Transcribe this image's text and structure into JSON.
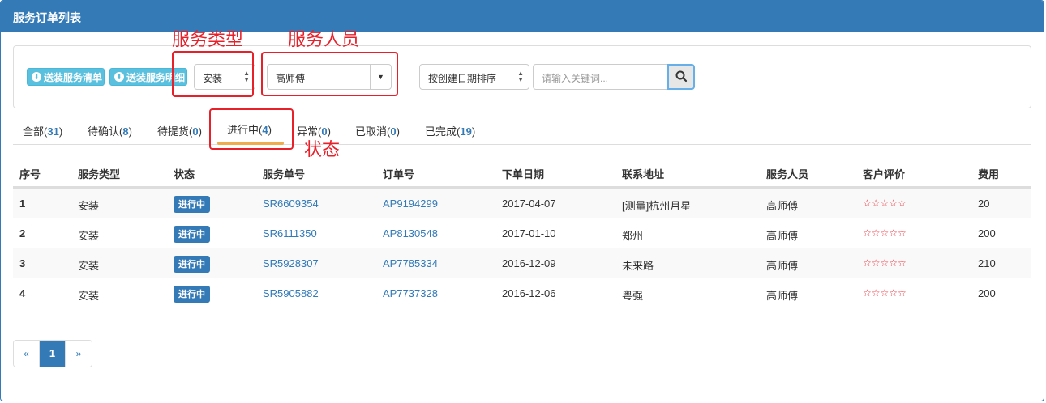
{
  "panel": {
    "title": "服务订单列表"
  },
  "toolbar": {
    "btn_list": "送装服务清单",
    "btn_detail": "送装服务明细",
    "service_type": "安装",
    "service_person": "高师傅",
    "sort": "按创建日期排序",
    "search_placeholder": "请输入关键词..."
  },
  "annotations": {
    "service_type": "服务类型",
    "service_person": "服务人员",
    "status": "状态"
  },
  "tabs": [
    {
      "label": "全部(",
      "count": "31",
      "close": ")"
    },
    {
      "label": "待确认(",
      "count": "8",
      "close": ")"
    },
    {
      "label": "待提货(",
      "count": "0",
      "close": ")"
    },
    {
      "label": "进行中(",
      "count": "4",
      "close": ")"
    },
    {
      "label": "异常(",
      "count": "0",
      "close": ")"
    },
    {
      "label": "已取消(",
      "count": "0",
      "close": ")"
    },
    {
      "label": "已完成(",
      "count": "19",
      "close": ")"
    }
  ],
  "table": {
    "headers": [
      "序号",
      "服务类型",
      "状态",
      "服务单号",
      "订单号",
      "下单日期",
      "联系地址",
      "服务人员",
      "客户评价",
      "费用"
    ],
    "rows": [
      {
        "no": "1",
        "type": "安装",
        "status": "进行中",
        "service_no": "SR6609354",
        "order_no": "AP9194299",
        "date": "2017-04-07",
        "address": "[测量]杭州月星",
        "person": "高师傅",
        "rating": "☆☆☆☆☆",
        "fee": "20"
      },
      {
        "no": "2",
        "type": "安装",
        "status": "进行中",
        "service_no": "SR6111350",
        "order_no": "AP8130548",
        "date": "2017-01-10",
        "address": "郑州",
        "person": "高师傅",
        "rating": "☆☆☆☆☆",
        "fee": "200"
      },
      {
        "no": "3",
        "type": "安装",
        "status": "进行中",
        "service_no": "SR5928307",
        "order_no": "AP7785334",
        "date": "2016-12-09",
        "address": "未来路",
        "person": "高师傅",
        "rating": "☆☆☆☆☆",
        "fee": "210"
      },
      {
        "no": "4",
        "type": "安装",
        "status": "进行中",
        "service_no": "SR5905882",
        "order_no": "AP7737328",
        "date": "2016-12-06",
        "address": "粤强",
        "person": "高师傅",
        "rating": "☆☆☆☆☆",
        "fee": "200"
      }
    ]
  },
  "pager": {
    "prev": "«",
    "current": "1",
    "next": "»"
  },
  "colors": {
    "primary": "#337ab7",
    "info": "#5bc0de",
    "annotation": "#e8202a",
    "tab_underline": "#f0ad4e"
  }
}
